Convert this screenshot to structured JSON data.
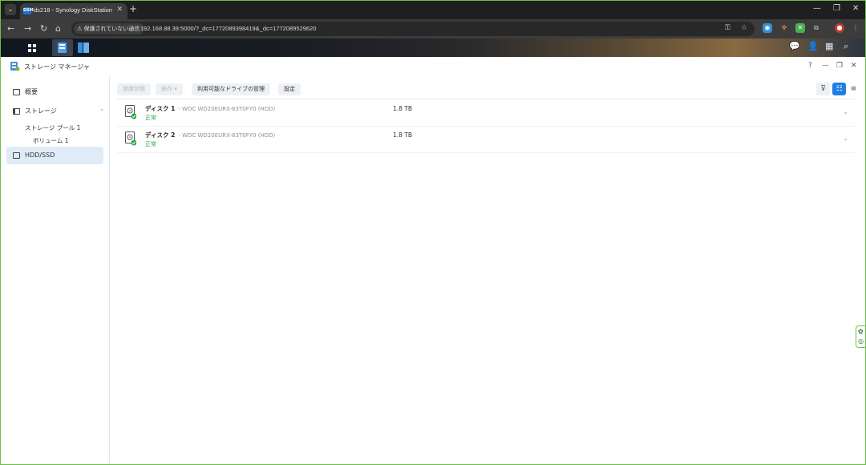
{
  "browser": {
    "tab_title": "ds218 - Synology DiskStation",
    "favicon_text": "DSM",
    "url": "192.168.88.39:5000/?_dc=1772089398419&_dc=1772089529620",
    "security_warning": "保護されていない通信"
  },
  "window": {
    "title": "ストレージ マネージャ",
    "help": "?"
  },
  "sidebar": {
    "items": [
      {
        "label": "概要"
      },
      {
        "label": "ストレージ"
      },
      {
        "label": "ストレージ プール 1"
      },
      {
        "label": "ボリューム 1"
      },
      {
        "label": "HDD/SSD"
      }
    ]
  },
  "toolbar": {
    "health_label": "健康状態",
    "action_label": "操作",
    "manage_label": "利用可能なドライブの管理",
    "settings_label": "設定"
  },
  "disks": [
    {
      "name": "ディスク 1",
      "model": "- WDC WD20EURX-63T0FY0 (HDD)",
      "status": "正常",
      "capacity": "1.8 TB"
    },
    {
      "name": "ディスク 2",
      "model": "- WDC WD20EURX-63T0FY0 (HDD)",
      "status": "正常",
      "capacity": "1.8 TB"
    }
  ],
  "colors": {
    "accent": "#1e7fe0",
    "status_ok": "#2ba84a",
    "active_nav_bg": "#dfecf8"
  }
}
